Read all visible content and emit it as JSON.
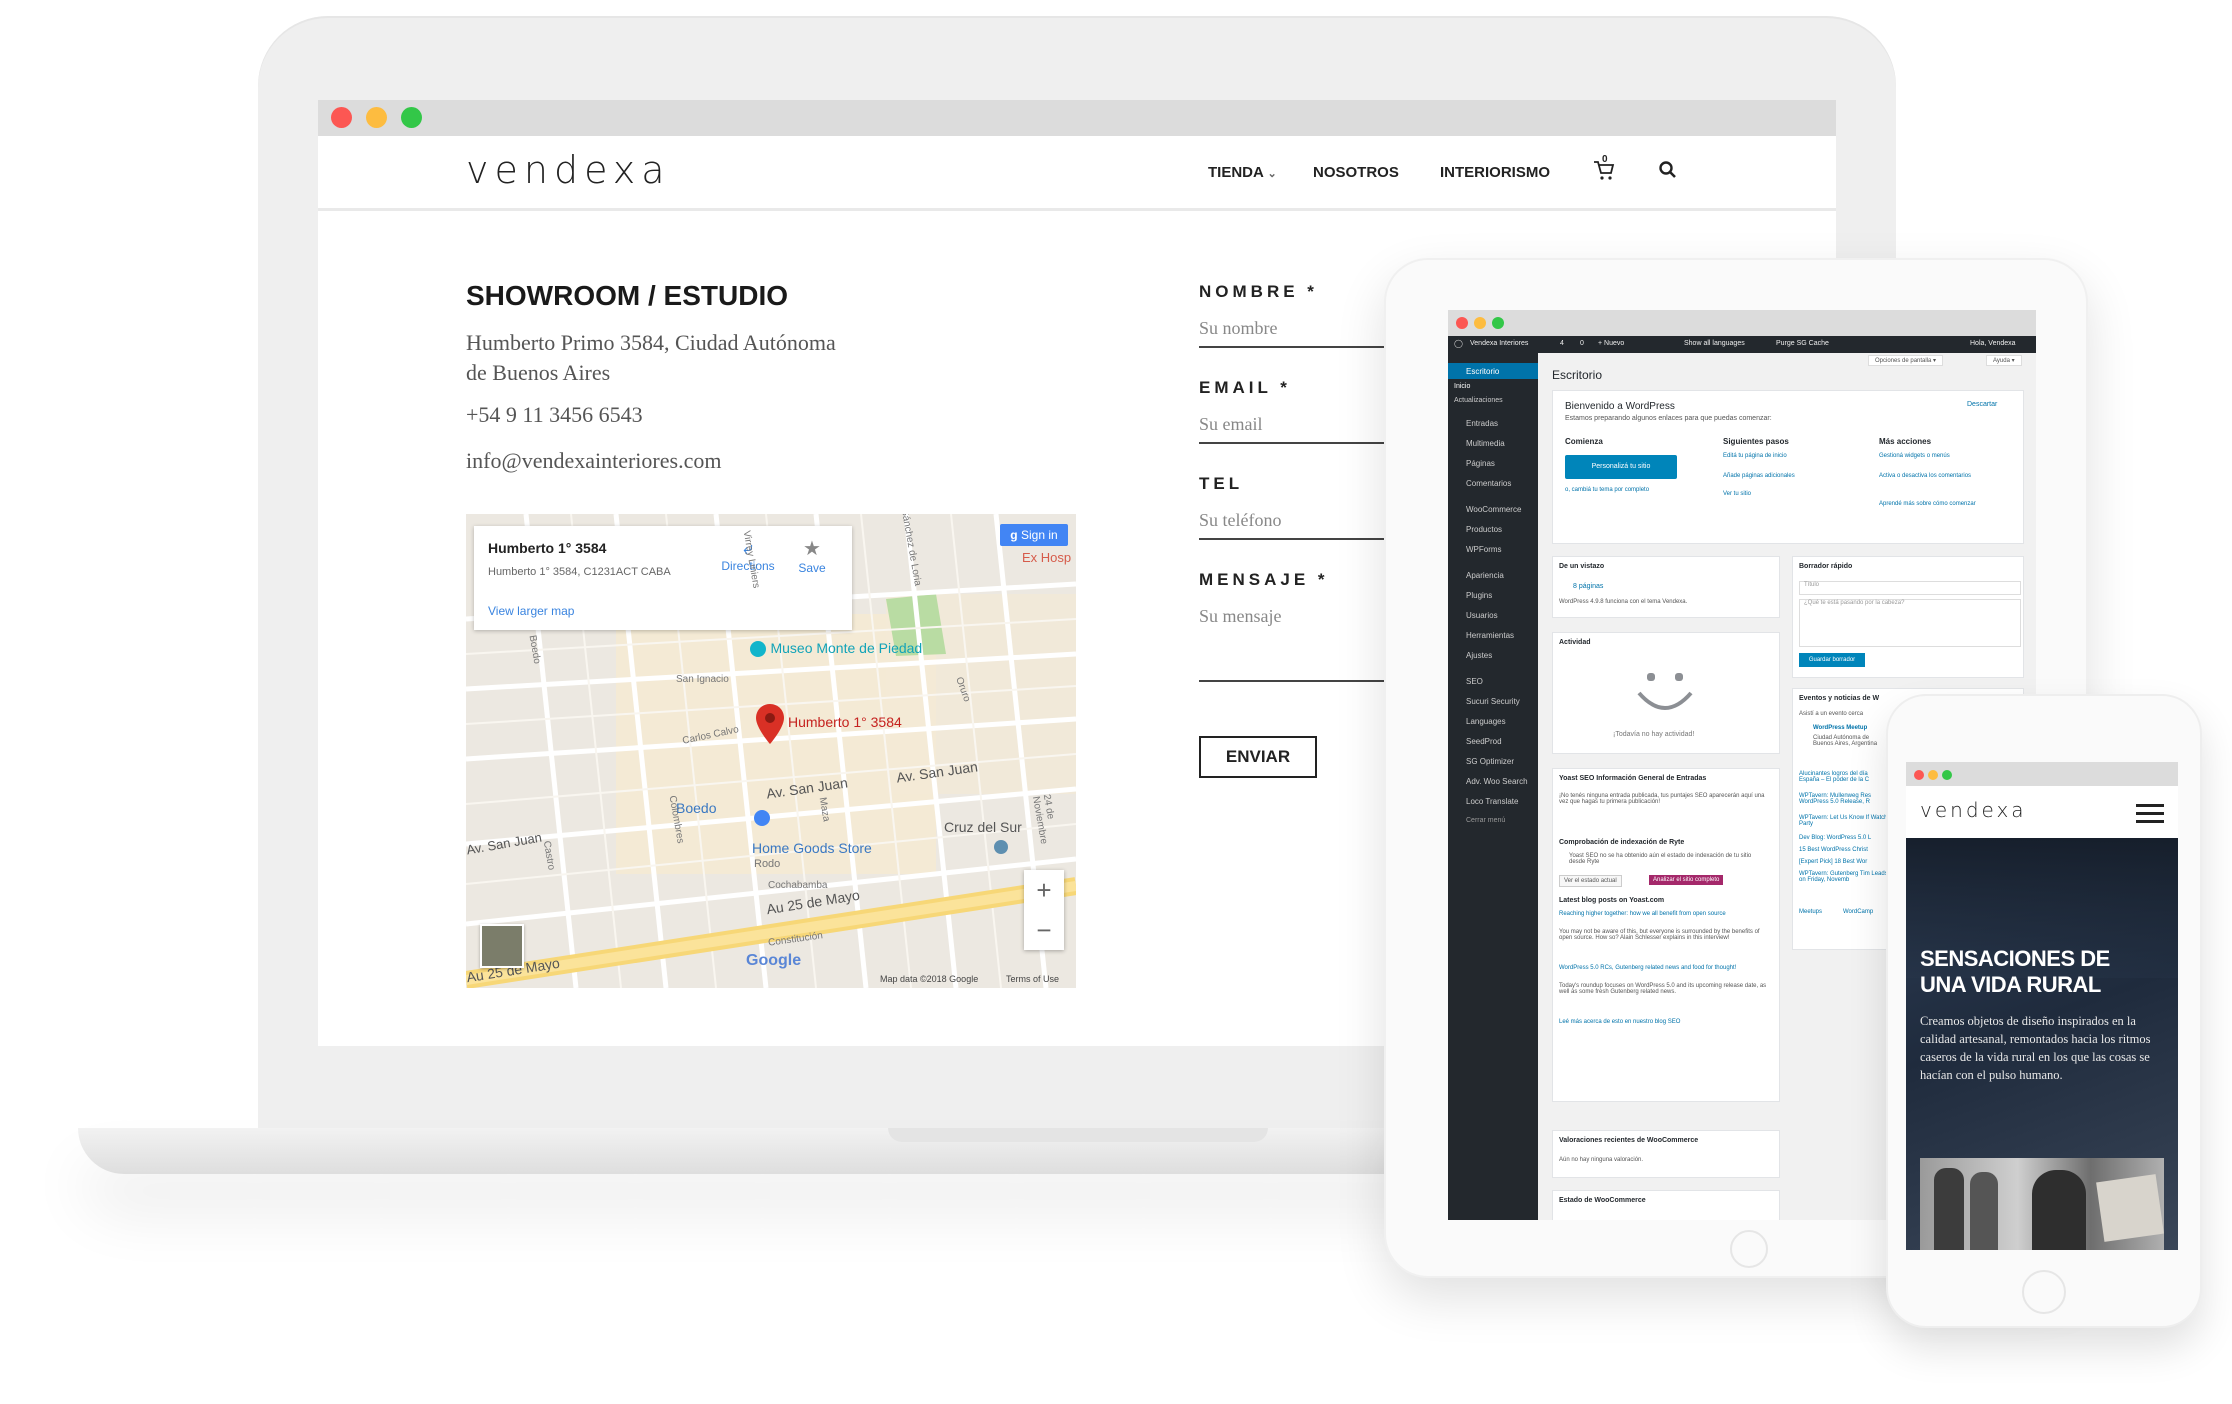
{
  "site": {
    "logo": "vendexa",
    "nav": [
      "TIENDA",
      "NOSOTROS",
      "INTERIORISMO"
    ],
    "cart_count": "0"
  },
  "contact": {
    "heading": "SHOWROOM / ESTUDIO",
    "address_line1": "Humberto Primo 3584, Ciudad Autónoma",
    "address_line2": "de Buenos Aires",
    "phone": "+54 9 11 3456 6543",
    "email": "info@vendexainteriores.com"
  },
  "map": {
    "place_title": "Humberto 1° 3584",
    "place_address": "Humberto 1° 3584, C1231ACT CABA",
    "directions": "Directions",
    "save": "Save",
    "view_larger": "View larger map",
    "sign_in": "Sign in",
    "ex_hosp": "Ex Hosp",
    "pin_label": "Humberto 1° 3584",
    "poi_museo": "Museo Monte de Piedad",
    "poi_home": "Home Goods Store",
    "poi_home_sub": "Rodo",
    "boedo": "Boedo",
    "cruz_del_sur": "Cruz del Sur",
    "av_san_juan": "Av. San Juan",
    "au_25_de_mayo": "Au 25 de Mayo",
    "streets": [
      "San Ignacio",
      "Carlos Calvo",
      "Cochabamba",
      "Constitución",
      "Colombres",
      "Maza",
      "Castro",
      "Virrey Liniers",
      "Oruro",
      "24 de Noviembre",
      "Boedo",
      "Sánchez de Loria"
    ],
    "footer_data": "Map data ©2018 Google",
    "footer_terms": "Terms of Use",
    "google": "Google"
  },
  "form": {
    "fields": [
      {
        "label": "NOMBRE *",
        "placeholder": "Su nombre"
      },
      {
        "label": "EMAIL *",
        "placeholder": "Su email"
      },
      {
        "label": "TEL",
        "placeholder": "Su teléfono"
      },
      {
        "label": "MENSAJE *",
        "placeholder": "Su mensaje"
      }
    ],
    "submit": "ENVIAR"
  },
  "wp": {
    "adminbar": [
      "Vendexa Interiores",
      "4",
      "0",
      "+ Nuevo",
      "Show all languages",
      "Purge SG Cache",
      "Hola, Vendexa"
    ],
    "screen_options": "Opciones de pantalla ▾",
    "help": "Ayuda ▾",
    "menu": [
      "Escritorio",
      "Inicio",
      "Actualizaciones",
      "Entradas",
      "Multimedia",
      "Páginas",
      "Comentarios",
      "WooCommerce",
      "Productos",
      "WPForms",
      "Apariencia",
      "Plugins",
      "Usuarios",
      "Herramientas",
      "Ajustes",
      "SEO",
      "Sucuri Security",
      "Languages",
      "SeedProd",
      "SG Optimizer",
      "Adv. Woo Search",
      "Loco Translate",
      "Cerrar menú"
    ],
    "page_title": "Escritorio",
    "welcome_title": "Bienvenido a WordPress",
    "welcome_sub": "Estamos preparando algunos enlaces para que puedas comenzar:",
    "dismiss": "Descartar",
    "col1_title": "Comienza",
    "col1_button": "Personalizá tu sitio",
    "col1_link": "o, cambiá tu tema por completo",
    "col2_title": "Siguientes pasos",
    "col2_links": [
      "Editá tu página de inicio",
      "Añade páginas adicionales",
      "Ver tu sitio"
    ],
    "col3_title": "Más acciones",
    "col3_links": [
      "Gestioná widgets o menús",
      "Activa o desactiva los comentarios",
      "Aprendé más sobre cómo comenzar"
    ],
    "glance_title": "De un vistazo",
    "glance_pages": "8 páginas",
    "glance_text": "WordPress 4.9.8 funciona con el tema Vendexa.",
    "activity_title": "Actividad",
    "activity_empty": "¡Todavía no hay actividad!",
    "yoast_title": "Yoast SEO Información General de Entradas",
    "yoast_text": "¡No tenés ninguna entrada publicada, tus puntajes SEO aparecerán aquí una vez que hagas tu primera publicación!",
    "ryte_title": "Comprobación de indexación de Ryte",
    "ryte_text": "Yoast SEO no se ha obtenido aún el estado de indexación de tu sitio desde Ryte",
    "ryte_btn1": "Ver el estado actual",
    "ryte_btn2": "Analizar el sitio completo",
    "blog_title": "Latest blog posts on Yoast.com",
    "blog_items": [
      {
        "link": "Reaching higher together: how we all benefit from open source",
        "text": "You may not be aware of this, but everyone is surrounded by the benefits of open source. How so? Alain Schlesser explains in this interview!"
      },
      {
        "link": "WordPress 5.0 RCs, Gutenberg related news and food for thought!",
        "text": "Today's roundup focuses on WordPress 5.0 and its upcoming release date, as well as some fresh Gutenberg related news."
      }
    ],
    "blog_more": "Leé más acerca de esto en nuestro blog SEO",
    "woo_reviews_title": "Valoraciones recientes de WooCommerce",
    "woo_reviews_text": "Aún no hay ninguna valoración.",
    "woo_status_title": "Estado de WooCommerce",
    "draft_title": "Borrador rápido",
    "draft_title_ph": "Título",
    "draft_body_ph": "¿Qué te está pasando por la cabeza?",
    "draft_btn": "Guardar borrador",
    "events_title": "Eventos y noticias de W",
    "events_sub": "Asistí a un evento cerca",
    "events_meetup": "WordPress Meetup",
    "events_loc": "Ciudad Autónoma de Buenos Aires, Argentina",
    "news": [
      "Alucinantes logros del día España – El poder de la C",
      "WPTavern: Mullenweg Res WordPress 5.0 Release, R",
      "WPTavern: Let Us Know If Watch Party",
      "Dev Blog: WordPress 5.0 L",
      "15 Best WordPress Christ",
      "[Expert Pick] 18 Best Wor",
      "WPTavern: Gutenberg Tim Leads on Friday, Novemb"
    ],
    "events_footer": [
      "Meetups",
      "WordCamp"
    ]
  },
  "phone_site": {
    "logo": "vendexa",
    "hero_title_1": "SENSACIONES DE",
    "hero_title_2": "UNA VIDA RURAL",
    "hero_text": "Creamos objetos de diseño inspirados en la calidad artesanal, remontados hacia los ritmos caseros de la vida rural en los que las cosas se hacían con el pulso humano."
  },
  "colors": {
    "accent_blue": "#0085ba",
    "wp_dark": "#23282d",
    "wp_active": "#0073aa",
    "ryte_pink": "#a4286a",
    "pin_red": "#d93025",
    "traffic_red": "#fc5753",
    "traffic_yellow": "#fdbc40",
    "traffic_green": "#33c748"
  }
}
